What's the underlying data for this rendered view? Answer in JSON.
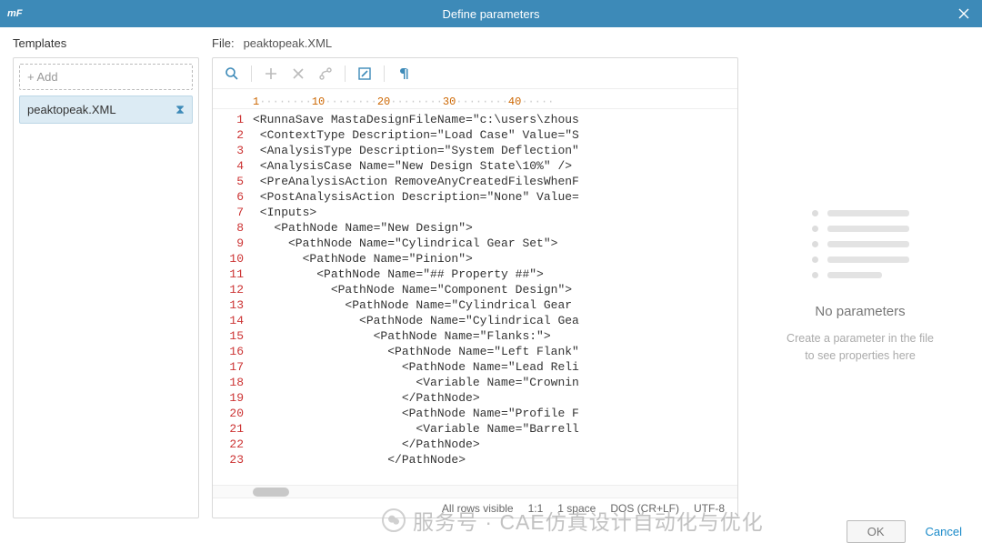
{
  "title": "Define parameters",
  "logo": "mF",
  "templates": {
    "heading": "Templates",
    "add_label": "Add",
    "files": [
      {
        "name": "peaktopeak.XML"
      }
    ]
  },
  "file": {
    "label": "File:",
    "name": "peaktopeak.XML"
  },
  "ruler_majors": [
    "1",
    "10",
    "20",
    "30",
    "40"
  ],
  "code_lines": [
    "<RunnaSave MastaDesignFileName=\"c:\\users\\zhous",
    " <ContextType Description=\"Load Case\" Value=\"S",
    " <AnalysisType Description=\"System Deflection\"",
    " <AnalysisCase Name=\"New Design State\\10%\" />",
    " <PreAnalysisAction RemoveAnyCreatedFilesWhenF",
    " <PostAnalysisAction Description=\"None\" Value=",
    " <Inputs>",
    "   <PathNode Name=\"New Design\">",
    "     <PathNode Name=\"Cylindrical Gear Set\">",
    "       <PathNode Name=\"Pinion\">",
    "         <PathNode Name=\"## Property ##\">",
    "           <PathNode Name=\"Component Design\">",
    "             <PathNode Name=\"Cylindrical Gear ",
    "               <PathNode Name=\"Cylindrical Gea",
    "                 <PathNode Name=\"Flanks:\">",
    "                   <PathNode Name=\"Left Flank\"",
    "                     <PathNode Name=\"Lead Reli",
    "                       <Variable Name=\"Crownin",
    "                     </PathNode>",
    "                     <PathNode Name=\"Profile F",
    "                       <Variable Name=\"Barrell",
    "                     </PathNode>",
    "                   </PathNode>"
  ],
  "status": {
    "rows": "All rows visible",
    "cursor": "1:1",
    "spacing": "1 space",
    "lineend": "DOS (CR+LF)",
    "encoding": "UTF-8"
  },
  "right": {
    "title": "No parameters",
    "line1": "Create a parameter in the file",
    "line2": "to see properties here"
  },
  "footer": {
    "ok": "OK",
    "cancel": "Cancel"
  },
  "watermark": "服务号 · CAE仿真设计自动化与优化"
}
